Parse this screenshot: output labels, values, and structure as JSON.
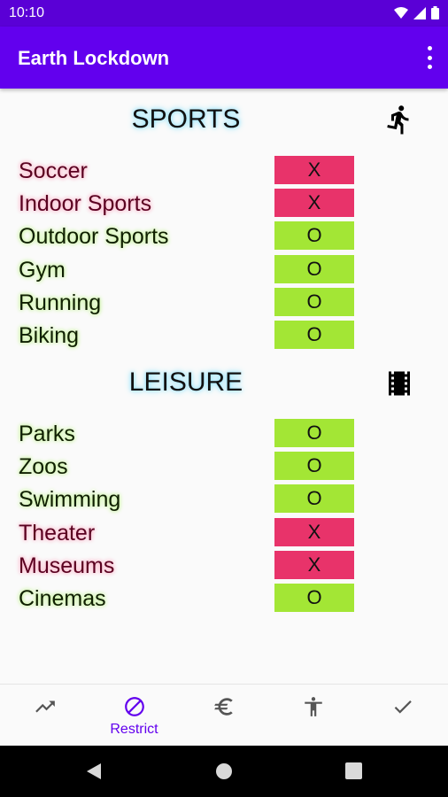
{
  "status_bar": {
    "time": "10:10"
  },
  "app_bar": {
    "title": "Earth Lockdown"
  },
  "sections": {
    "sports": {
      "title": "SPORTS",
      "icon": "running-person-icon",
      "rows": [
        {
          "label": "Soccer",
          "status": "X"
        },
        {
          "label": "Indoor Sports",
          "status": "X"
        },
        {
          "label": "Outdoor Sports",
          "status": "O"
        },
        {
          "label": "Gym",
          "status": "O"
        },
        {
          "label": "Running",
          "status": "O"
        },
        {
          "label": "Biking",
          "status": "O"
        }
      ]
    },
    "leisure": {
      "title": "LEISURE",
      "icon": "film-strip-icon",
      "rows": [
        {
          "label": "Parks",
          "status": "O"
        },
        {
          "label": "Zoos",
          "status": "O"
        },
        {
          "label": "Swimming",
          "status": "O"
        },
        {
          "label": "Theater",
          "status": "X"
        },
        {
          "label": "Museums",
          "status": "X"
        },
        {
          "label": "Cinemas",
          "status": "O"
        }
      ]
    }
  },
  "bottom_nav": {
    "items": [
      {
        "icon": "trending-up-icon",
        "label": ""
      },
      {
        "icon": "block-icon",
        "label": "Restrict"
      },
      {
        "icon": "euro-icon",
        "label": ""
      },
      {
        "icon": "accessibility-icon",
        "label": ""
      },
      {
        "icon": "check-icon",
        "label": ""
      }
    ],
    "selected": 1
  },
  "colors": {
    "primary": "#6200ee",
    "status_bar": "#5a00d6",
    "open": "#a3e635",
    "closed": "#e8336a"
  }
}
